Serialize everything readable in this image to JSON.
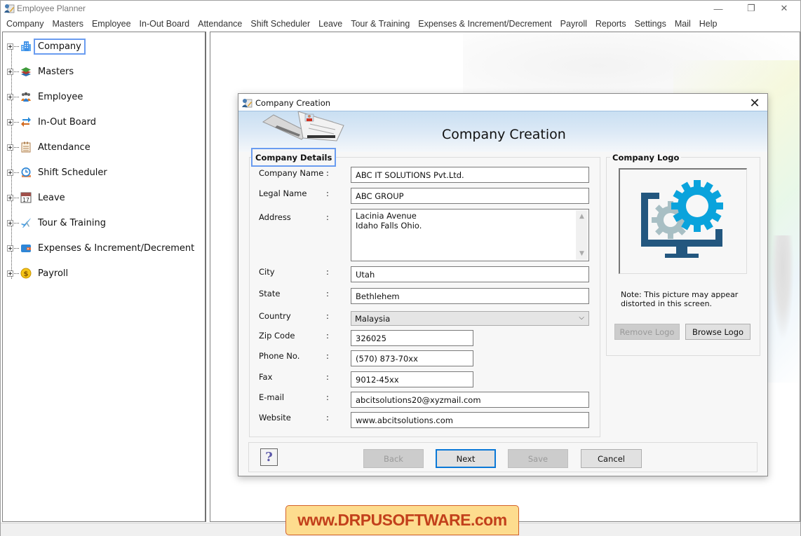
{
  "app": {
    "title": "Employee Planner",
    "window_controls": {
      "minimize": "—",
      "maximize": "❐",
      "close": "✕"
    }
  },
  "menubar": {
    "items": [
      "Company",
      "Masters",
      "Employee",
      "In-Out Board",
      "Attendance",
      "Shift Scheduler",
      "Leave",
      "Tour & Training",
      "Expenses & Increment/Decrement",
      "Payroll",
      "Reports",
      "Settings",
      "Mail",
      "Help"
    ]
  },
  "tree": {
    "selected": "Company",
    "items": [
      {
        "label": "Company",
        "icon": "building-icon"
      },
      {
        "label": "Masters",
        "icon": "layers-icon"
      },
      {
        "label": "Employee",
        "icon": "people-icon"
      },
      {
        "label": "In-Out Board",
        "icon": "arrows-exchange-icon"
      },
      {
        "label": "Attendance",
        "icon": "clipboard-icon"
      },
      {
        "label": "Shift Scheduler",
        "icon": "clock-icon"
      },
      {
        "label": "Leave",
        "icon": "calendar-icon",
        "icon_text": "17"
      },
      {
        "label": "Tour & Training",
        "icon": "airplane-icon"
      },
      {
        "label": "Expenses & Increment/Decrement",
        "icon": "wallet-icon"
      },
      {
        "label": "Payroll",
        "icon": "dollar-coin-icon",
        "icon_text": "$"
      }
    ]
  },
  "dialog": {
    "title": "Company Creation",
    "close_label": "✕",
    "banner_title": "Company Creation",
    "details_group_title": "Company Details",
    "colon": ":",
    "fields": {
      "company_name": {
        "label": "Company Name",
        "value": "ABC IT SOLUTIONS Pvt.Ltd."
      },
      "legal_name": {
        "label": "Legal Name",
        "value": "ABC GROUP"
      },
      "address": {
        "label": "Address",
        "line1": "Lacinia Avenue",
        "line2": "Idaho Falls Ohio."
      },
      "city": {
        "label": "City",
        "value": "Utah"
      },
      "state": {
        "label": "State",
        "value": "Bethlehem"
      },
      "country": {
        "label": "Country",
        "value": "Malaysia"
      },
      "zip_code": {
        "label": "Zip Code",
        "value": "326025"
      },
      "phone": {
        "label": "Phone No.",
        "value": "(570) 873-70xx"
      },
      "fax": {
        "label": "Fax",
        "value": "9012-45xx"
      },
      "email": {
        "label": "E-mail",
        "value": "abcitsolutions20@xyzmail.com"
      },
      "website": {
        "label": "Website",
        "value": "www.abcitsolutions.com"
      }
    },
    "logo": {
      "group_title": "Company Logo",
      "note": "Note: This picture may appear distorted in this screen.",
      "remove_label": "Remove Logo",
      "browse_label": "Browse Logo",
      "colors": {
        "monitor": "#23577f",
        "gear_blue": "#0aa3dc",
        "gear_grey": "#a8bfc4"
      }
    },
    "footer": {
      "help_label": "?",
      "back_label": "Back",
      "next_label": "Next",
      "save_label": "Save",
      "cancel_label": "Cancel"
    }
  },
  "watermark": {
    "text": "www.DRPUSOFTWARE.com"
  },
  "colors": {
    "selection_border": "#6a9cf0",
    "default_button_border": "#0a78d7",
    "watermark_bg": "#fddc8e",
    "watermark_text": "#c2401b"
  }
}
